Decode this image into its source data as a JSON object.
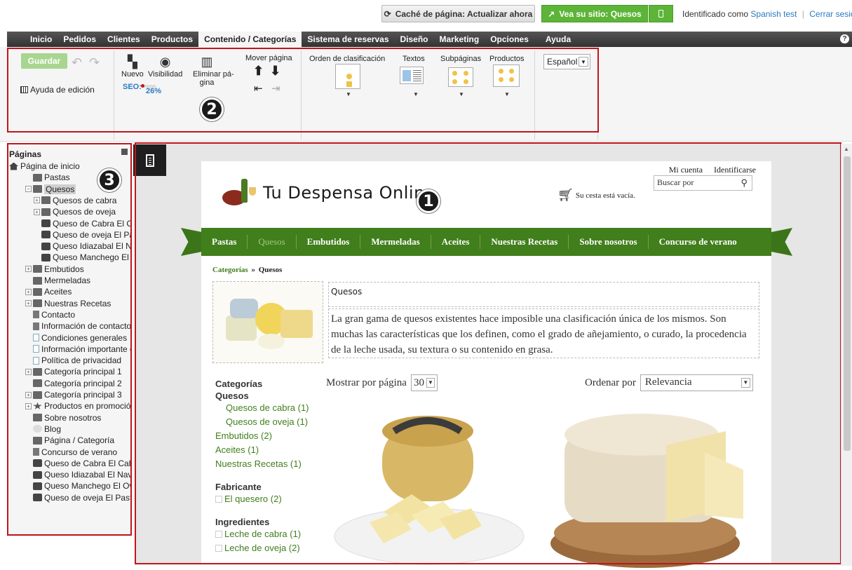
{
  "topbar": {
    "cache_button": "Caché de página: Actualizar ahora",
    "site_button": "Vea su sitio: Quesos",
    "identified_prefix": "Identificado como",
    "user_link": "Spanish test",
    "logout_link": "Cerrar sesión"
  },
  "menu": {
    "items": [
      "Inicio",
      "Pedidos",
      "Clientes",
      "Productos",
      "Contenido / Categorías",
      "Sistema de reservas",
      "Diseño",
      "Marketing",
      "Opciones",
      "Ayuda"
    ],
    "active": "Contenido / Categorías",
    "help_icon": "?"
  },
  "toolbar": {
    "save": "Guardar",
    "edit_help": "Ayuda de edición",
    "new": "Nuevo",
    "visibility": "Visibilidad",
    "delete_line1": "Eliminar pá-",
    "delete_line2": "gina",
    "seo_label": "SEO:",
    "seo_percent": "26%",
    "seo_value": 0.26,
    "move_page": "Mover página",
    "sort_order": "Orden de clasificación",
    "texts": "Textos",
    "subpages": "Subpáginas",
    "products": "Productos",
    "language": "Español"
  },
  "badges": {
    "one": "1",
    "two": "2",
    "three": "3"
  },
  "sidebar": {
    "title": "Páginas",
    "items": [
      {
        "label": "Página de inicio",
        "icon": "home-icon"
      },
      {
        "label": "Pastas",
        "icon": "folder-icon"
      },
      {
        "label": "Quesos",
        "icon": "folder-icon"
      },
      {
        "label": "Quesos de cabra",
        "icon": "folder-icon"
      },
      {
        "label": "Quesos de oveja",
        "icon": "folder-icon"
      },
      {
        "label": "Queso de Cabra El Cabr",
        "icon": "product-icon"
      },
      {
        "label": "Queso de oveja El Pasto",
        "icon": "product-icon"
      },
      {
        "label": "Queso Idiazabal El Nava",
        "icon": "product-icon"
      },
      {
        "label": "Queso Manchego El Ove",
        "icon": "product-icon"
      },
      {
        "label": "Embutidos",
        "icon": "folder-icon"
      },
      {
        "label": "Mermeladas",
        "icon": "folder-icon"
      },
      {
        "label": "Aceites",
        "icon": "folder-icon"
      },
      {
        "label": "Nuestras Recetas",
        "icon": "folder-icon"
      },
      {
        "label": "Contacto",
        "icon": "form-icon"
      },
      {
        "label": "Información de contacto",
        "icon": "page-icon"
      },
      {
        "label": "Condiciones generales",
        "icon": "link-icon"
      },
      {
        "label": "Información importante del c",
        "icon": "link-icon"
      },
      {
        "label": "Política de privacidad",
        "icon": "link-icon"
      },
      {
        "label": "Categoría principal 1",
        "icon": "folder-icon"
      },
      {
        "label": "Categoría principal 2",
        "icon": "folder-icon"
      },
      {
        "label": "Categoría principal 3",
        "icon": "folder-icon"
      },
      {
        "label": "Productos en promoción",
        "icon": "star-icon"
      },
      {
        "label": "Sobre nosotros",
        "icon": "folder-icon"
      },
      {
        "label": "Blog",
        "icon": "blog-icon"
      },
      {
        "label": "Página / Categoría",
        "icon": "folder-icon"
      },
      {
        "label": "Concurso de verano",
        "icon": "form-icon"
      },
      {
        "label": "Queso de Cabra El Cabrero",
        "icon": "product-icon"
      },
      {
        "label": "Queso Idiazabal El Navarro",
        "icon": "product-icon"
      },
      {
        "label": "Queso Manchego El Ovejun",
        "icon": "product-icon"
      },
      {
        "label": "Queso de oveja El Pastor",
        "icon": "product-icon"
      }
    ],
    "selected": "Quesos"
  },
  "shop": {
    "logo_text": "Tu Despensa Online",
    "my_account": "Mi cuenta",
    "login": "Identificarse",
    "search_placeholder": "Buscar por",
    "cart_text": "Su cesta está vacía.",
    "nav": [
      "Pastas",
      "Quesos",
      "Embutidos",
      "Mermeladas",
      "Aceites",
      "Nuestras Recetas",
      "Sobre nosotros",
      "Concurso de verano"
    ],
    "nav_active": "Quesos",
    "breadcrumb_root": "Categorías",
    "breadcrumb_sep": "»",
    "breadcrumb_current": "Quesos",
    "category_title": "Quesos",
    "category_description": "La gran gama de quesos existentes hace imposible una clasificación única de los mismos. Son muchas las características que los definen, como el grado de añejamiento, o curado, la procedencia de la leche usada, su textura o su contenido en grasa.",
    "facets": {
      "categories_heading": "Categorías",
      "current": "Quesos",
      "sub": [
        "Quesos de cabra (1)",
        "Quesos de oveja (1)"
      ],
      "others": [
        "Embutidos (2)",
        "Aceites (1)",
        "Nuestras Recetas (1)"
      ],
      "maker_heading": "Fabricante",
      "makers": [
        "El quesero (2)"
      ],
      "ingredients_heading": "Ingredientes",
      "ingredients": [
        "Leche de cabra (1)",
        "Leche de oveja (2)"
      ]
    },
    "per_page_label": "Mostrar por página",
    "per_page_value": "30",
    "sort_label": "Ordenar por",
    "sort_value": "Relevancia"
  }
}
